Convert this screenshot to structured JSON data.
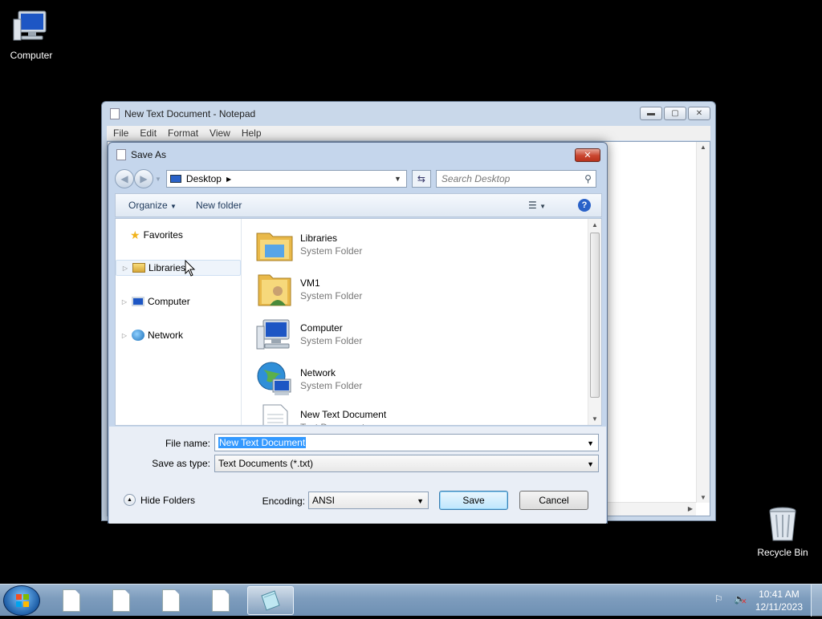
{
  "desktop": {
    "icons": [
      {
        "label": "Computer"
      },
      {
        "label": "Recycle Bin"
      }
    ]
  },
  "notepad": {
    "title": "New Text Document - Notepad",
    "menu": [
      "File",
      "Edit",
      "Format",
      "View",
      "Help"
    ]
  },
  "dialog": {
    "title": "Save As",
    "address": "Desktop",
    "search_placeholder": "Search Desktop",
    "toolbar": {
      "organize": "Organize",
      "new_folder": "New folder"
    },
    "nav_items": [
      {
        "label": "Favorites",
        "icon": "star-icon"
      },
      {
        "label": "Libraries",
        "icon": "libraries-icon",
        "selected": true
      },
      {
        "label": "Computer",
        "icon": "computer-icon"
      },
      {
        "label": "Network",
        "icon": "network-icon"
      }
    ],
    "files": [
      {
        "name": "Libraries",
        "type": "System Folder",
        "icon": "libraries-folder-icon"
      },
      {
        "name": "VM1",
        "type": "System Folder",
        "icon": "user-folder-icon"
      },
      {
        "name": "Computer",
        "type": "System Folder",
        "icon": "computer-icon"
      },
      {
        "name": "Network",
        "type": "System Folder",
        "icon": "network-globe-icon"
      },
      {
        "name": "New Text Document",
        "type": "Text Document",
        "icon": "text-document-icon"
      }
    ],
    "file_name_label": "File name:",
    "file_name_value": "New Text Document",
    "save_type_label": "Save as type:",
    "save_type_value": "Text Documents (*.txt)",
    "hide_folders": "Hide Folders",
    "encoding_label": "Encoding:",
    "encoding_value": "ANSI",
    "save_button": "Save",
    "cancel_button": "Cancel"
  },
  "taskbar": {
    "time": "10:41 AM",
    "date": "12/11/2023"
  },
  "colors": {
    "selection": "#3399ff",
    "dialog_frame": "#c5d6ec",
    "taskbar": "#7d9cbd"
  }
}
